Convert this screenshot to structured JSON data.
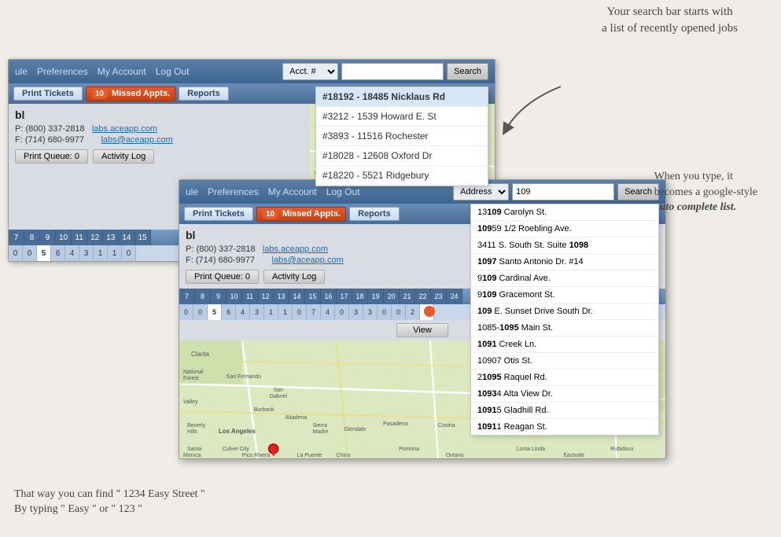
{
  "annotations": {
    "top_right": "Your search bar starts with\na list of recently opened jobs",
    "mid_right_line1": "When you type, it",
    "mid_right_line2": "becomes a google-style",
    "mid_right_line3": "auto complete list.",
    "bottom_left_line1": "That way you can find \" 1234 Easy Street \"",
    "bottom_left_line2": "By typing \" Easy \" or \" 123 \""
  },
  "window1": {
    "nav": {
      "items": [
        "ule",
        "Preferences",
        "My Account",
        "Log Out"
      ],
      "search_label": "Acct. #",
      "search_placeholder": "",
      "search_btn": "Search"
    },
    "subnav": {
      "print": "Print Tickets",
      "missed_count": "10",
      "missed": "Missed Appts.",
      "reports": "Reports"
    },
    "content": {
      "title": "bl",
      "phone": "P: (800) 337-2818",
      "fax": "F: (714) 680-9977",
      "email1": "labs.aceapp.com",
      "email2": "labs@aceapp.com",
      "print_queue": "Print Queue: 0",
      "activity_log": "Activity Log"
    },
    "calendar": {
      "headers": [
        "7",
        "8",
        "9",
        "10",
        "11",
        "12",
        "13",
        "14",
        "15"
      ],
      "values": [
        "0",
        "0",
        "5",
        "6",
        "4",
        "3",
        "1",
        "1",
        "0"
      ]
    },
    "autocomplete": {
      "items": [
        "#18192 - 18485 Nicklaus Rd",
        "#3212 - 1539 Howard E. St",
        "#3893 - 11516 Rochester",
        "#18028 - 12608 Oxford Dr",
        "#18220 - 5521 Ridgebury"
      ]
    }
  },
  "window2": {
    "nav": {
      "items": [
        "ule",
        "Preferences",
        "My Account",
        "Log Out"
      ],
      "search_label": "Address",
      "search_value": "109",
      "search_btn": "Search"
    },
    "subnav": {
      "print": "Print Tickets",
      "missed_count": "10",
      "missed": "Missed Appts.",
      "reports": "Reports"
    },
    "content": {
      "title": "bl",
      "phone": "P: (800) 337-2818",
      "fax": "F: (714) 680-9977",
      "email1": "labs.aceapp.com",
      "email2": "labs@aceapp.com",
      "print_queue": "Print Queue: 0",
      "activity_log": "Activity Log"
    },
    "calendar": {
      "headers": [
        "7",
        "8",
        "9",
        "10",
        "11",
        "12",
        "13",
        "14",
        "15",
        "16",
        "17",
        "18",
        "19",
        "20",
        "21",
        "22",
        "23",
        "24"
      ],
      "values": [
        "0",
        "0",
        "5",
        "6",
        "4",
        "3",
        "1",
        "1",
        "0",
        "7",
        "4",
        "0",
        "3",
        "3",
        "0",
        "0",
        "2",
        ""
      ]
    },
    "view_btn": "View",
    "autocomplete": {
      "items": [
        {
          "text": "131",
          "bold": "09",
          "rest": " Carolyn St."
        },
        {
          "text": "109",
          "bold": "59",
          "rest": " 1/2 Roebling Ave."
        },
        {
          "text": "3411 S. South St. Suite ",
          "bold": "1098",
          "rest": ""
        },
        {
          "text": "",
          "bold": "1097",
          "rest": " Santo Antonio Dr. #14"
        },
        {
          "text": "9",
          "bold": "109",
          "rest": " Cardinal Ave."
        },
        {
          "text": "9",
          "bold": "109",
          "rest": " Gracemont St."
        },
        {
          "text": "",
          "bold": "109",
          "rest": " E. Sunset Drive South Dr."
        },
        {
          "text": "1085-",
          "bold": "1095",
          "rest": " Main St."
        },
        {
          "text": "",
          "bold": "1091",
          "rest": " Creek Ln."
        },
        {
          "text": "10907 Otis St.",
          "bold": "",
          "rest": ""
        },
        {
          "text": "2",
          "bold": "1095",
          "rest": " Raquel Rd."
        },
        {
          "text": "",
          "bold": "1093",
          "rest": "4 Alta View Dr."
        },
        {
          "text": "",
          "bold": "1091",
          "rest": "5 Gladhill Rd."
        },
        {
          "text": "",
          "bold": "1091",
          "rest": "1 Reagan St."
        }
      ]
    }
  }
}
